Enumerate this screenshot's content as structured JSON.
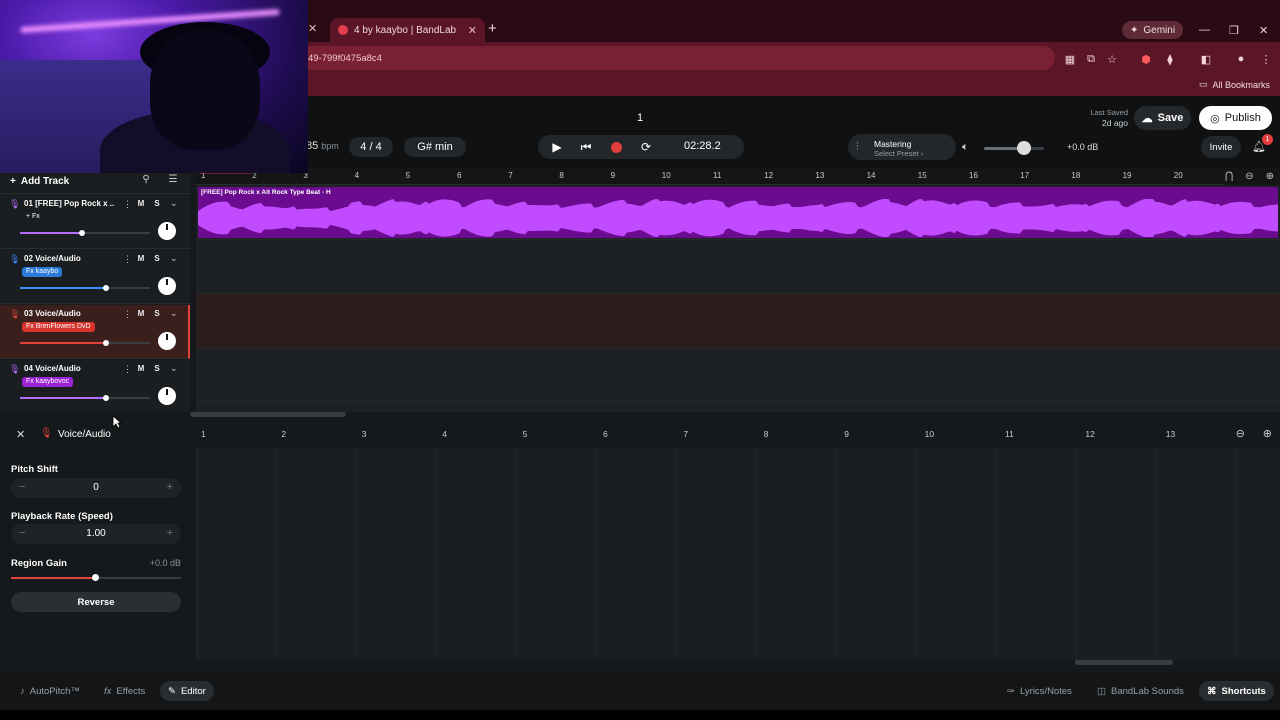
{
  "browser": {
    "tab_title": "4 by kaaybo | BandLab",
    "url": "49-799f0475a8c4",
    "gemini_label": "Gemini",
    "all_bookmarks": "All Bookmarks"
  },
  "header": {
    "project_title": "1",
    "last_saved_label": "Last Saved",
    "last_saved_value": "2d ago",
    "save_label": "Save",
    "publish_label": "Publish",
    "tempo_value": "85",
    "tempo_unit": "bpm",
    "time_signature": "4 / 4",
    "key": "G# min",
    "time": "02:28.2",
    "mastering_label": "Mastering",
    "mastering_preset": "Select Preset ›",
    "volume_db": "+0.0 dB",
    "invite_label": "Invite",
    "notification_count": "1"
  },
  "tracks_panel": {
    "add_track_label": "Add Track",
    "tracks": [
      {
        "name": "01  [FREE] Pop Rock x ...",
        "fx": "+ Fx",
        "fx_color": "#1b1e20",
        "volume": 0.48,
        "color": "#b46dff"
      },
      {
        "name": "02  Voice/Audio",
        "fx": "Fx kaaybo",
        "fx_color": "#2a7ad8",
        "volume": 0.66,
        "color": "#3a8bff"
      },
      {
        "name": "03  Voice/Audio",
        "fx": "Fx BrenFlowers DvD",
        "fx_color": "#d8342c",
        "volume": 0.66,
        "color": "#e0443a"
      },
      {
        "name": "04  Voice/Audio",
        "fx": "Fx kaaybovoc",
        "fx_color": "#9b22d6",
        "volume": 0.66,
        "color": "#b46dff"
      }
    ],
    "mute_label": "M",
    "solo_label": "S"
  },
  "arrangement": {
    "ruler": [
      "1",
      "2",
      "3",
      "4",
      "5",
      "6",
      "7",
      "8",
      "9",
      "10",
      "11",
      "12",
      "13",
      "14",
      "15",
      "16",
      "17",
      "18",
      "19",
      "20"
    ],
    "region_label": "[FREE] Pop Rock x Alt Rock Type Beat - H"
  },
  "editor": {
    "title": "Voice/Audio",
    "pitch_shift_label": "Pitch Shift",
    "pitch_shift_value": "0",
    "playback_rate_label": "Playback Rate (Speed)",
    "playback_rate_value": "1.00",
    "region_gain_label": "Region Gain",
    "region_gain_value": "+0.0 dB",
    "region_gain_level": 0.5,
    "reverse_label": "Reverse",
    "ruler": [
      "1",
      "2",
      "3",
      "4",
      "5",
      "6",
      "7",
      "8",
      "9",
      "10",
      "11",
      "12",
      "13"
    ]
  },
  "bottom_bar": {
    "autopitch": "AutoPitch™",
    "effects": "Effects",
    "editor": "Editor",
    "lyrics": "Lyrics/Notes",
    "sounds": "BandLab Sounds",
    "shortcuts": "Shortcuts"
  },
  "colors": {
    "accent_red": "#e0443a",
    "region_purple": "#6b0b8f",
    "waveform": "#c14cff",
    "browser_frame": "#5a1526"
  }
}
